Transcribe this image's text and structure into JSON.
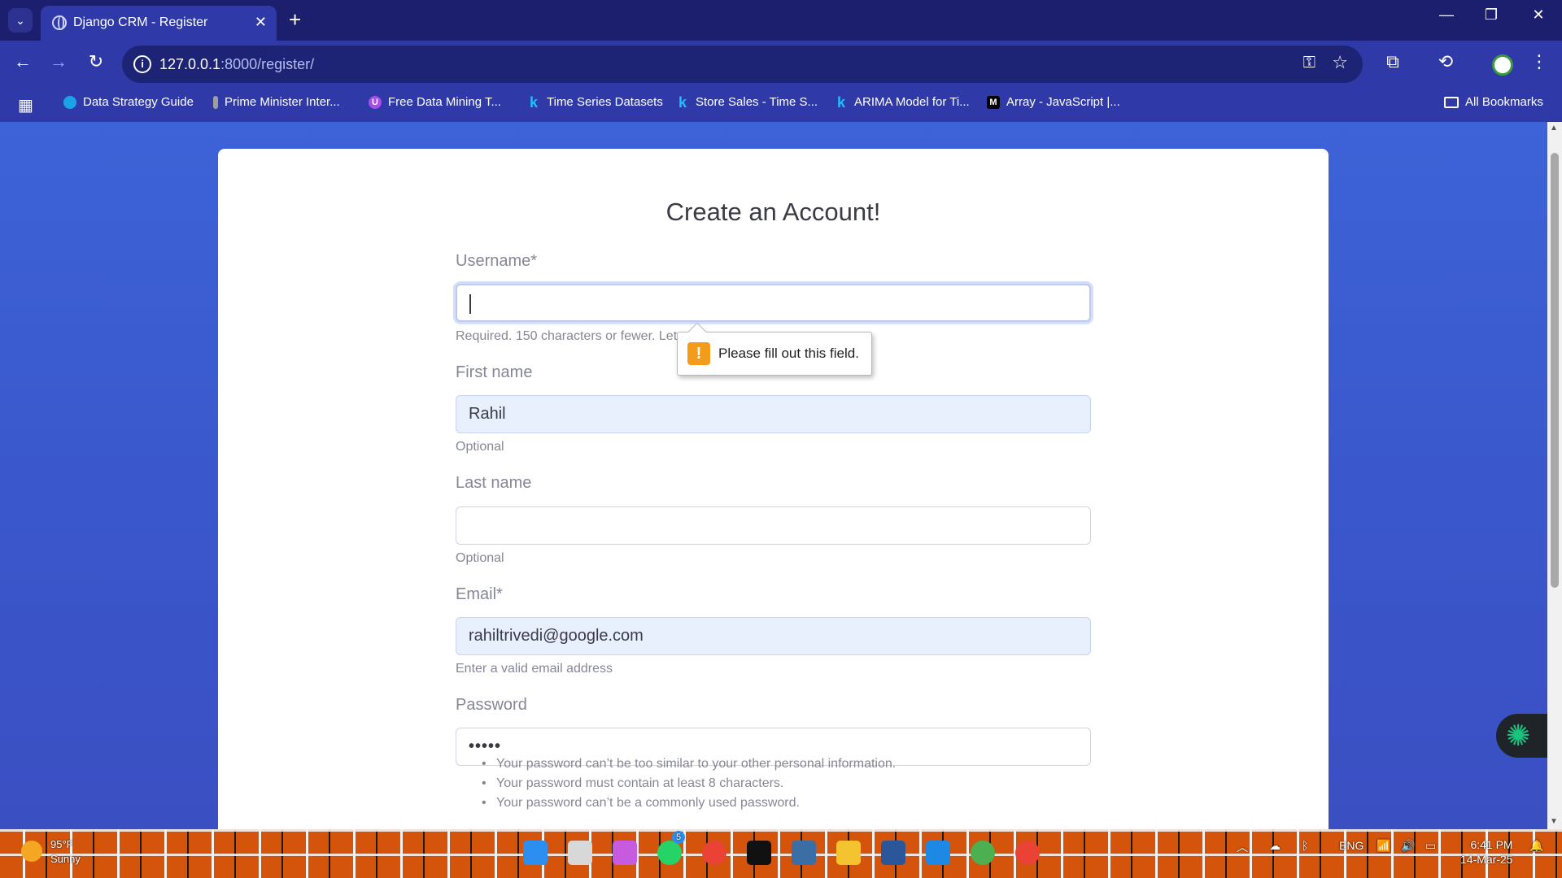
{
  "browser": {
    "tab_title": "Django CRM - Register",
    "url_host": "127.0.0.1",
    "url_path": ":8000/register/",
    "bookmarks": [
      {
        "label": "Data Strategy Guide",
        "icon": "cloud-icon",
        "color": "#1ba3e8"
      },
      {
        "label": "Prime Minister Inter...",
        "icon": "page-icon",
        "color": "#9e9e9e"
      },
      {
        "label": "Free Data Mining T...",
        "icon": "shield-icon",
        "color": "#a64ee6"
      },
      {
        "label": "Time Series Datasets",
        "icon": "kaggle-icon",
        "color": "#20beff"
      },
      {
        "label": "Store Sales - Time S...",
        "icon": "kaggle-icon",
        "color": "#20beff"
      },
      {
        "label": "ARIMA Model for Ti...",
        "icon": "kaggle-icon",
        "color": "#20beff"
      },
      {
        "label": "Array - JavaScript |...",
        "icon": "mdn-icon",
        "color": "#000000"
      }
    ],
    "all_bookmarks": "All Bookmarks"
  },
  "page": {
    "heading": "Create an Account!",
    "fields": {
      "username": {
        "label": "Username*",
        "value": "",
        "help": "Required. 150 characters or fewer. Let"
      },
      "first_name": {
        "label": "First name",
        "value": "Rahil",
        "help": "Optional"
      },
      "last_name": {
        "label": "Last name",
        "value": "",
        "help": "Optional"
      },
      "email": {
        "label": "Email*",
        "value": "rahiltrivedi@google.com",
        "help": "Enter a valid email address"
      },
      "password": {
        "label": "Password",
        "value": "•••••"
      }
    },
    "password_rules": [
      "Your password can’t be too similar to your other personal information.",
      "Your password must contain at least 8 characters.",
      "Your password can’t be a commonly used password."
    ],
    "validation_tooltip": "Please fill out this field.",
    "warning_icon_glyph": "!"
  },
  "taskbar": {
    "temperature": "95°F",
    "condition": "Sunny",
    "language": "ENG",
    "time": "6:41 PM",
    "date": "14-Mar-25",
    "badge_count": "5"
  },
  "colors": {
    "accent": "#4e73df",
    "autofill_bg": "#e8f0fe",
    "warning": "#f39b1b"
  }
}
